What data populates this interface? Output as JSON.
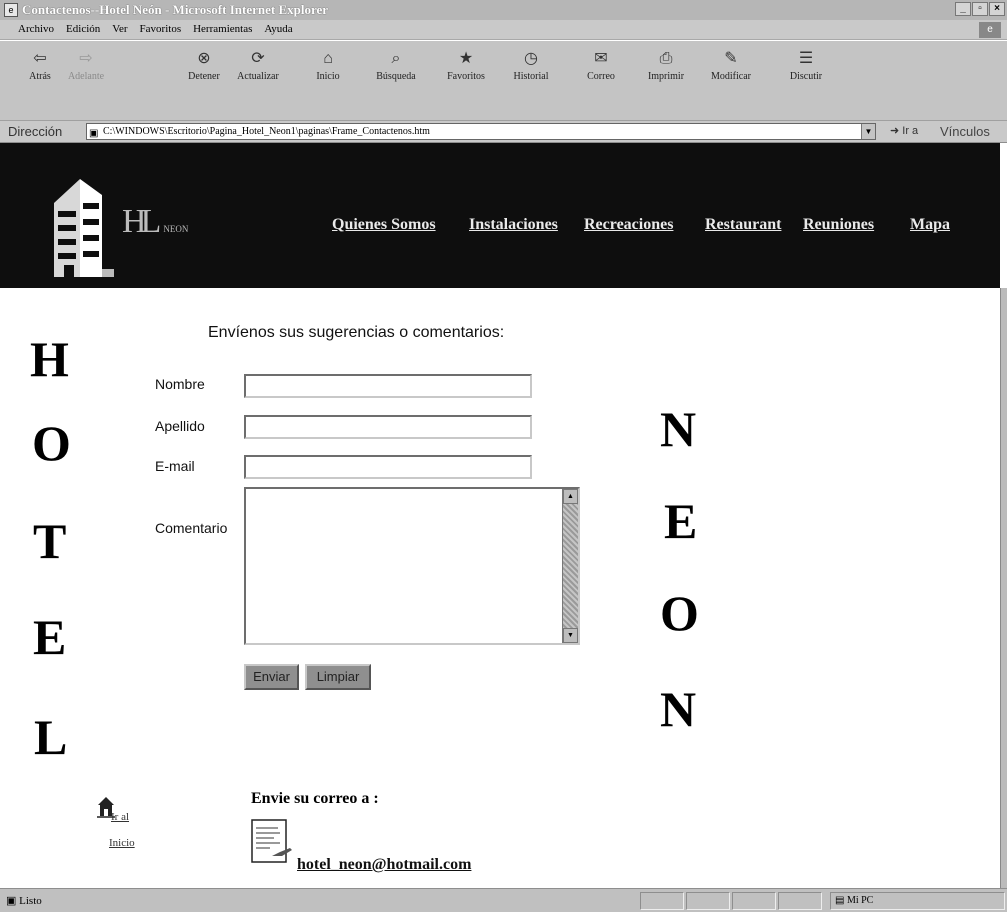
{
  "window": {
    "title": "Contactenos--Hotel Neón - Microsoft Internet Explorer",
    "minimize": "_",
    "maximize": "▫",
    "close": "×"
  },
  "menu": [
    "Archivo",
    "Edición",
    "Ver",
    "Favoritos",
    "Herramientas",
    "Ayuda"
  ],
  "toolbar": [
    {
      "label": "Atrás",
      "icon": "back-arrow-icon",
      "glyph": "⇦",
      "enabled": true
    },
    {
      "label": "Adelante",
      "icon": "forward-arrow-icon",
      "glyph": "⇨",
      "enabled": false
    },
    {
      "label": "Detener",
      "icon": "stop-icon",
      "glyph": "⊗",
      "enabled": true
    },
    {
      "label": "Actualizar",
      "icon": "refresh-icon",
      "glyph": "⟳",
      "enabled": true
    },
    {
      "label": "Inicio",
      "icon": "home-icon",
      "glyph": "⌂",
      "enabled": true
    },
    {
      "label": "Búsqueda",
      "icon": "search-icon",
      "glyph": "⌕",
      "enabled": true
    },
    {
      "label": "Favoritos",
      "icon": "favorites-icon",
      "glyph": "★",
      "enabled": true
    },
    {
      "label": "Historial",
      "icon": "history-icon",
      "glyph": "◷",
      "enabled": true
    },
    {
      "label": "Correo",
      "icon": "mail-icon",
      "glyph": "✉",
      "enabled": true
    },
    {
      "label": "Imprimir",
      "icon": "print-icon",
      "glyph": "⎙",
      "enabled": true
    },
    {
      "label": "Modificar",
      "icon": "edit-icon",
      "glyph": "✎",
      "enabled": true
    },
    {
      "label": "Discutir",
      "icon": "discuss-icon",
      "glyph": "☰",
      "enabled": true
    }
  ],
  "address": {
    "label": "Dirección",
    "url": "C:\\WINDOWS\\Escritorio\\Pagina_Hotel_Neon1\\paginas\\Frame_Contactenos.htm",
    "go": "Ir a",
    "links": "Vínculos"
  },
  "header": {
    "logo_letters": "HL",
    "logo_text": "NEON",
    "nav": [
      "Quienes Somos",
      "Instalaciones",
      "Recreaciones",
      "Restaurant",
      "Reuniones",
      "Mapa"
    ]
  },
  "decor": {
    "left": [
      "H",
      "O",
      "T",
      "E",
      "L"
    ],
    "right": [
      "N",
      "E",
      "O",
      "N"
    ]
  },
  "form": {
    "title": "Envíenos sus sugerencias o comentarios:",
    "name_label": "Nombre",
    "surname_label": "Apellido",
    "email_label": "E-mail",
    "comment_label": "Comentario",
    "name_value": "",
    "surname_value": "",
    "email_value": "",
    "comment_value": "",
    "send": "Enviar",
    "clear": "Limpiar"
  },
  "home_link": {
    "line1": "Ir al",
    "line2": "Inicio"
  },
  "mail": {
    "title": "Envie su correo a :",
    "address": "hotel_neon@hotmail.com"
  },
  "status": {
    "text": "Listo",
    "zone": "Mi PC"
  }
}
